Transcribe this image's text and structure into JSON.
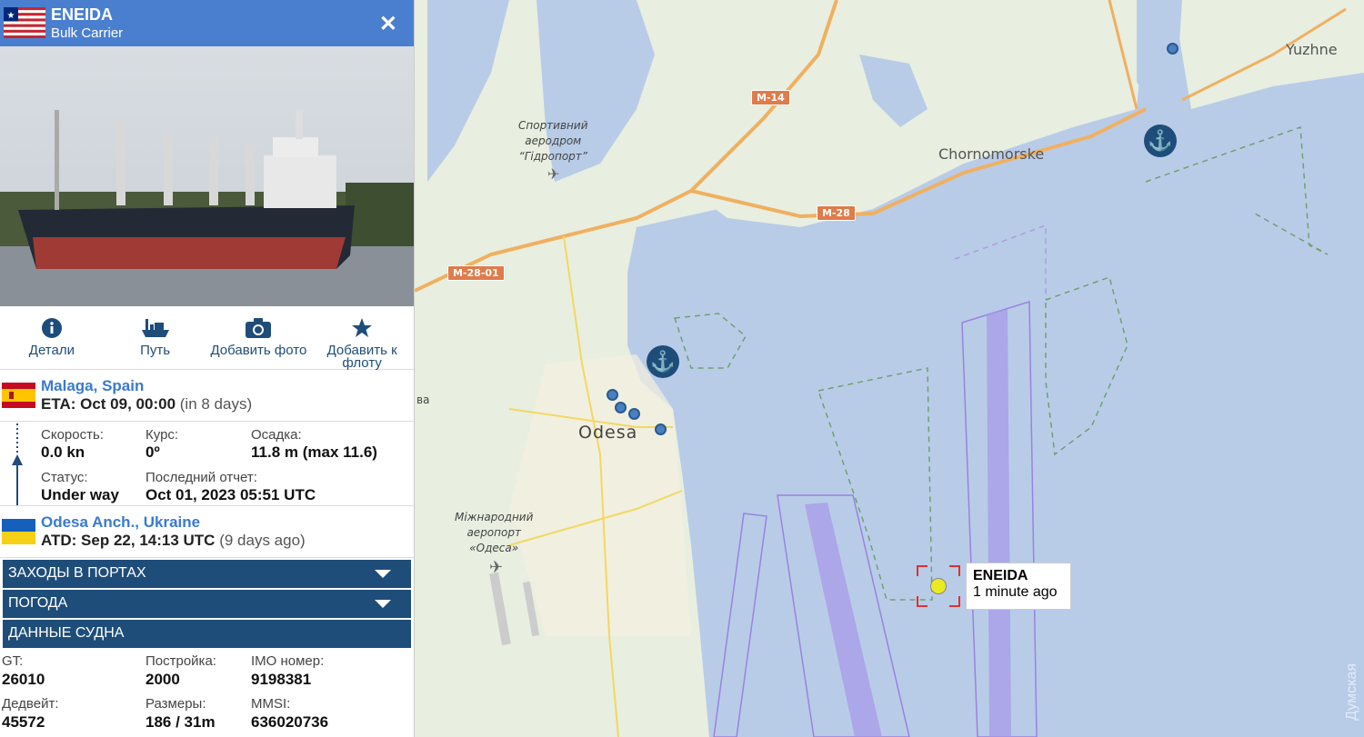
{
  "vessel": {
    "name": "ENEIDA",
    "type": "Bulk Carrier",
    "flag": "liberia-flag"
  },
  "actions": [
    {
      "label": "Детали",
      "icon": "info-icon"
    },
    {
      "label": "Путь",
      "icon": "ship-route-icon"
    },
    {
      "label": "Добавить фото",
      "icon": "camera-icon"
    },
    {
      "label": "Добавить к флоту",
      "icon": "star-icon"
    }
  ],
  "destination": {
    "name": "Malaga, Spain",
    "eta_label": "ETA: Oct 09, 00:00",
    "eta_relative": "(in 8 days)",
    "flag": "spain-flag"
  },
  "stats": {
    "speed_label": "Скорость:",
    "speed_value": "0.0 kn",
    "course_label": "Курс:",
    "course_value": "0º",
    "draught_label": "Осадка:",
    "draught_value": "11.8 m (max 11.6)",
    "status_label": "Статус:",
    "status_value": "Under way",
    "report_label": "Последний отчет:",
    "report_value": "Oct 01, 2023 05:51 UTC"
  },
  "origin": {
    "name": "Odesa Anch., Ukraine",
    "atd_label": "ATD: Sep 22, 14:13 UTC",
    "atd_relative": "(9 days ago)",
    "flag": "ukraine-flag"
  },
  "sections": {
    "port_calls": "ЗАХОДЫ В ПОРТАХ",
    "weather": "ПОГОДА",
    "vessel_data": "ДАННЫЕ СУДНА"
  },
  "vessel_data": {
    "gt_label": "GT:",
    "gt_value": "26010",
    "built_label": "Постройка:",
    "built_value": "2000",
    "imo_label": "IMO номер:",
    "imo_value": "9198381",
    "dwt_label": "Дедвейт:",
    "dwt_value": "45572",
    "size_label": "Размеры:",
    "size_value": "186 / 31m",
    "mmsi_label": "MMSI:",
    "mmsi_value": "636020736"
  },
  "map": {
    "labels": {
      "odesa": "Odesa",
      "chornomorske": "Chornomorske",
      "yuzhne": "Yuzhne",
      "sport_airfield": "Спортивний\nаеродром\n“Гідропорт”",
      "intl_airport": "Міжнародний\nаеропорт\n«Одеса»",
      "partial": "ва"
    },
    "roads": {
      "m14": "M-14",
      "m28": "M-28",
      "m2801": "M-28-01"
    },
    "popup": {
      "name": "ENEIDA",
      "time": "1 minute ago"
    },
    "watermark": "Думская"
  },
  "colors": {
    "header": "#4a7fd0",
    "section": "#1f4d7a",
    "link": "#3a7ad0",
    "sea": "#b8cce8",
    "land": "#e8eee0"
  }
}
